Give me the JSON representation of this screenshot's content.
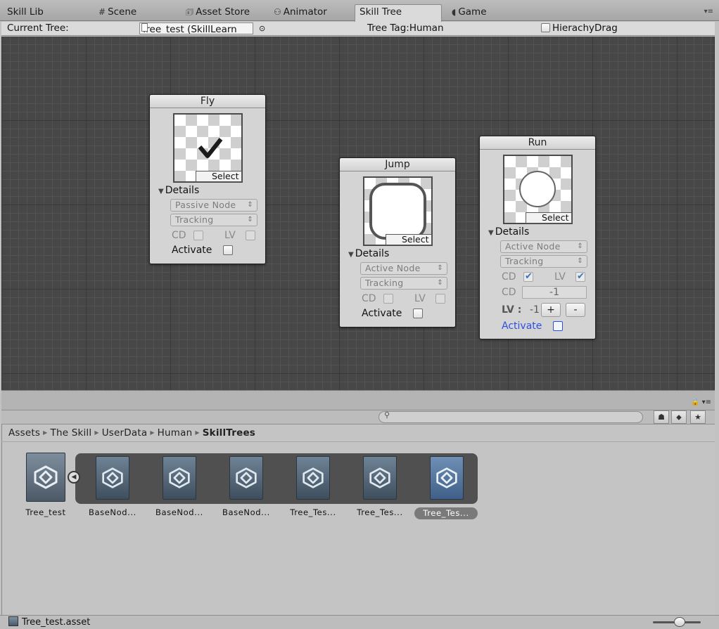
{
  "tabs": [
    {
      "label": "Skill Lib",
      "icon": ""
    },
    {
      "label": "Scene",
      "icon": "#"
    },
    {
      "label": "Asset Store",
      "icon": "🗊"
    },
    {
      "label": "Animator",
      "icon": "⚇"
    },
    {
      "label": "Skill Tree",
      "icon": ""
    },
    {
      "label": "Game",
      "icon": "◖"
    }
  ],
  "active_tab": "Skill Tree",
  "toolbar": {
    "current_tree_label": "Current Tree:",
    "tree_value": "Tree_test (SkillLearn",
    "tree_tag": "Tree Tag:Human",
    "hierarchy_drag": "HierachyDrag"
  },
  "nodes": {
    "fly": {
      "title": "Fly",
      "select": "Select",
      "details": "Details",
      "type": "Passive Node",
      "mode": "Tracking",
      "cd": "CD",
      "lv": "LV",
      "activate": "Activate"
    },
    "jump": {
      "title": "Jump",
      "select": "Select",
      "details": "Details",
      "type": "Active Node",
      "mode": "Tracking",
      "cd": "CD",
      "lv": "LV",
      "activate": "Activate"
    },
    "run": {
      "title": "Run",
      "select": "Select",
      "details": "Details",
      "type": "Active Node",
      "mode": "Tracking",
      "cd": "CD",
      "lv": "LV",
      "cd_value": "-1",
      "lv_label": "LV :",
      "lv_value": "-1",
      "plus": "+",
      "minus": "-",
      "activate": "Activate",
      "cd_checked": true,
      "lv_checked": true
    }
  },
  "breadcrumb": [
    "Assets",
    "The Skill",
    "UserData",
    "Human",
    "SkillTrees"
  ],
  "assets": [
    {
      "label": "Tree_test",
      "selected": false
    },
    {
      "label": "BaseNod...",
      "selected": false
    },
    {
      "label": "BaseNod...",
      "selected": false
    },
    {
      "label": "BaseNod...",
      "selected": false
    },
    {
      "label": "Tree_Tes...",
      "selected": false
    },
    {
      "label": "Tree_Tes...",
      "selected": false
    },
    {
      "label": "Tree_Tes...",
      "selected": true
    }
  ],
  "status": {
    "text": "Tree_test.asset"
  },
  "colors": {
    "canvas": "#474747",
    "node": "#d4d4d4",
    "activate_blue": "#2c4fe0",
    "selection": "#7a7a7a"
  }
}
